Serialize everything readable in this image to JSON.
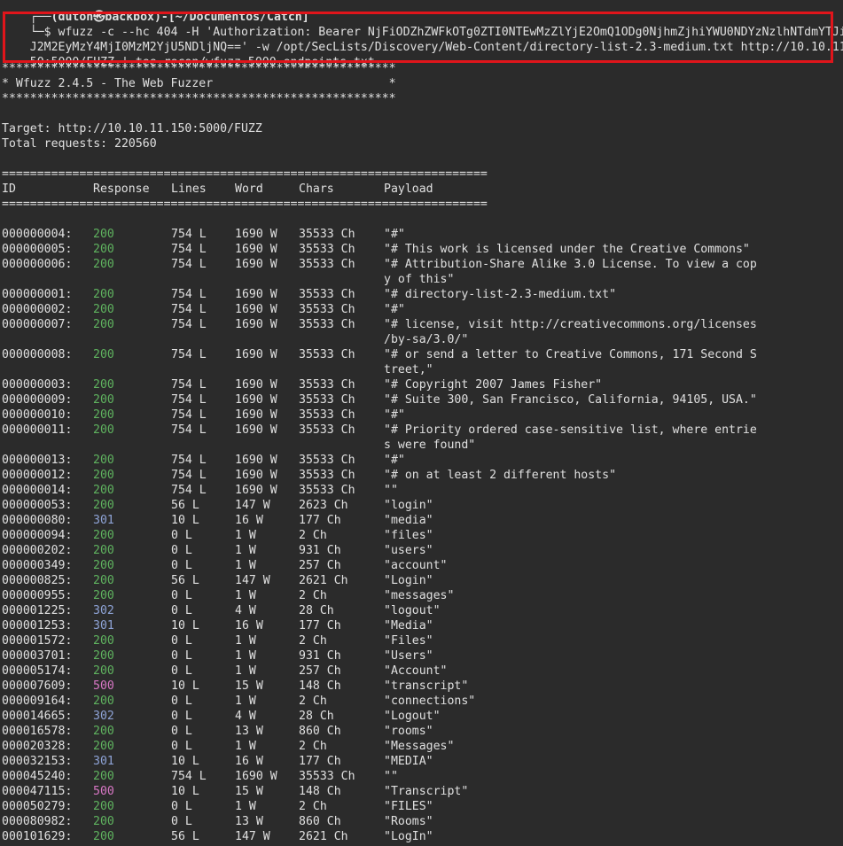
{
  "prompt": {
    "line": "┌──(duton㉿backbox)-[~/Documentos/Catch]",
    "dollar": "└─$",
    "command": [
      " wfuzz -c --hc 404 -H 'Authorization: Bearer NjFiODZhZWFkOTg0ZTI0NTEwMzZlYjE2OmQ1ODg0NjhmZjhiYWU0NDYzNzlhNTdmYTJiN",
      "J2M2EyMzY4MjI0MzM2YjU5NDljNQ==' -w /opt/SecLists/Discovery/Web-Content/directory-list-2.3-medium.txt http://10.10.11.1",
      "50:5000/FUZZ | tee recon/wfuzz-5000-endpoints.txt"
    ]
  },
  "banner": {
    "stars": "********************************************************",
    "title": "* Wfuzz 2.4.5 - The Web Fuzzer                         *"
  },
  "target_line": "Target: http://10.10.11.150:5000/FUZZ",
  "total_line": "Total requests: 220560",
  "separator": "=====================================================================",
  "headers": {
    "id": "ID",
    "response": "Response",
    "lines": "Lines",
    "word": "Word",
    "chars": "Chars",
    "payload": "Payload"
  },
  "colors": {
    "status_2xx": "#5fb35f",
    "status_3xx": "#8ea3d6",
    "status_5xx": "#d877c5",
    "highlight": "#e0151b"
  },
  "results": [
    {
      "id": "000000004:",
      "code": "200",
      "lines": "754 L",
      "words": "1690 W",
      "chars": "35533 Ch",
      "payload": [
        "\"#\""
      ]
    },
    {
      "id": "000000005:",
      "code": "200",
      "lines": "754 L",
      "words": "1690 W",
      "chars": "35533 Ch",
      "payload": [
        "\"# This work is licensed under the Creative Commons\""
      ]
    },
    {
      "id": "000000006:",
      "code": "200",
      "lines": "754 L",
      "words": "1690 W",
      "chars": "35533 Ch",
      "payload": [
        "\"# Attribution-Share Alike 3.0 License. To view a cop",
        "y of this\""
      ]
    },
    {
      "id": "000000001:",
      "code": "200",
      "lines": "754 L",
      "words": "1690 W",
      "chars": "35533 Ch",
      "payload": [
        "\"# directory-list-2.3-medium.txt\""
      ]
    },
    {
      "id": "000000002:",
      "code": "200",
      "lines": "754 L",
      "words": "1690 W",
      "chars": "35533 Ch",
      "payload": [
        "\"#\""
      ]
    },
    {
      "id": "000000007:",
      "code": "200",
      "lines": "754 L",
      "words": "1690 W",
      "chars": "35533 Ch",
      "payload": [
        "\"# license, visit http://creativecommons.org/licenses",
        "/by-sa/3.0/\""
      ]
    },
    {
      "id": "000000008:",
      "code": "200",
      "lines": "754 L",
      "words": "1690 W",
      "chars": "35533 Ch",
      "payload": [
        "\"# or send a letter to Creative Commons, 171 Second S",
        "treet,\""
      ]
    },
    {
      "id": "000000003:",
      "code": "200",
      "lines": "754 L",
      "words": "1690 W",
      "chars": "35533 Ch",
      "payload": [
        "\"# Copyright 2007 James Fisher\""
      ]
    },
    {
      "id": "000000009:",
      "code": "200",
      "lines": "754 L",
      "words": "1690 W",
      "chars": "35533 Ch",
      "payload": [
        "\"# Suite 300, San Francisco, California, 94105, USA.\""
      ]
    },
    {
      "id": "000000010:",
      "code": "200",
      "lines": "754 L",
      "words": "1690 W",
      "chars": "35533 Ch",
      "payload": [
        "\"#\""
      ]
    },
    {
      "id": "000000011:",
      "code": "200",
      "lines": "754 L",
      "words": "1690 W",
      "chars": "35533 Ch",
      "payload": [
        "\"# Priority ordered case-sensitive list, where entrie",
        "s were found\""
      ]
    },
    {
      "id": "000000013:",
      "code": "200",
      "lines": "754 L",
      "words": "1690 W",
      "chars": "35533 Ch",
      "payload": [
        "\"#\""
      ]
    },
    {
      "id": "000000012:",
      "code": "200",
      "lines": "754 L",
      "words": "1690 W",
      "chars": "35533 Ch",
      "payload": [
        "\"# on at least 2 different hosts\""
      ]
    },
    {
      "id": "000000014:",
      "code": "200",
      "lines": "754 L",
      "words": "1690 W",
      "chars": "35533 Ch",
      "payload": [
        "\"\""
      ]
    },
    {
      "id": "000000053:",
      "code": "200",
      "lines": "56 L",
      "words": "147 W",
      "chars": "2623 Ch",
      "payload": [
        "\"login\""
      ]
    },
    {
      "id": "000000080:",
      "code": "301",
      "lines": "10 L",
      "words": "16 W",
      "chars": "177 Ch",
      "payload": [
        "\"media\""
      ]
    },
    {
      "id": "000000094:",
      "code": "200",
      "lines": "0 L",
      "words": "1 W",
      "chars": "2 Ch",
      "payload": [
        "\"files\""
      ]
    },
    {
      "id": "000000202:",
      "code": "200",
      "lines": "0 L",
      "words": "1 W",
      "chars": "931 Ch",
      "payload": [
        "\"users\""
      ]
    },
    {
      "id": "000000349:",
      "code": "200",
      "lines": "0 L",
      "words": "1 W",
      "chars": "257 Ch",
      "payload": [
        "\"account\""
      ]
    },
    {
      "id": "000000825:",
      "code": "200",
      "lines": "56 L",
      "words": "147 W",
      "chars": "2621 Ch",
      "payload": [
        "\"Login\""
      ]
    },
    {
      "id": "000000955:",
      "code": "200",
      "lines": "0 L",
      "words": "1 W",
      "chars": "2 Ch",
      "payload": [
        "\"messages\""
      ]
    },
    {
      "id": "000001225:",
      "code": "302",
      "lines": "0 L",
      "words": "4 W",
      "chars": "28 Ch",
      "payload": [
        "\"logout\""
      ]
    },
    {
      "id": "000001253:",
      "code": "301",
      "lines": "10 L",
      "words": "16 W",
      "chars": "177 Ch",
      "payload": [
        "\"Media\""
      ]
    },
    {
      "id": "000001572:",
      "code": "200",
      "lines": "0 L",
      "words": "1 W",
      "chars": "2 Ch",
      "payload": [
        "\"Files\""
      ]
    },
    {
      "id": "000003701:",
      "code": "200",
      "lines": "0 L",
      "words": "1 W",
      "chars": "931 Ch",
      "payload": [
        "\"Users\""
      ]
    },
    {
      "id": "000005174:",
      "code": "200",
      "lines": "0 L",
      "words": "1 W",
      "chars": "257 Ch",
      "payload": [
        "\"Account\""
      ]
    },
    {
      "id": "000007609:",
      "code": "500",
      "lines": "10 L",
      "words": "15 W",
      "chars": "148 Ch",
      "payload": [
        "\"transcript\""
      ]
    },
    {
      "id": "000009164:",
      "code": "200",
      "lines": "0 L",
      "words": "1 W",
      "chars": "2 Ch",
      "payload": [
        "\"connections\""
      ]
    },
    {
      "id": "000014665:",
      "code": "302",
      "lines": "0 L",
      "words": "4 W",
      "chars": "28 Ch",
      "payload": [
        "\"Logout\""
      ]
    },
    {
      "id": "000016578:",
      "code": "200",
      "lines": "0 L",
      "words": "13 W",
      "chars": "860 Ch",
      "payload": [
        "\"rooms\""
      ]
    },
    {
      "id": "000020328:",
      "code": "200",
      "lines": "0 L",
      "words": "1 W",
      "chars": "2 Ch",
      "payload": [
        "\"Messages\""
      ]
    },
    {
      "id": "000032153:",
      "code": "301",
      "lines": "10 L",
      "words": "16 W",
      "chars": "177 Ch",
      "payload": [
        "\"MEDIA\""
      ]
    },
    {
      "id": "000045240:",
      "code": "200",
      "lines": "754 L",
      "words": "1690 W",
      "chars": "35533 Ch",
      "payload": [
        "\"\""
      ]
    },
    {
      "id": "000047115:",
      "code": "500",
      "lines": "10 L",
      "words": "15 W",
      "chars": "148 Ch",
      "payload": [
        "\"Transcript\""
      ]
    },
    {
      "id": "000050279:",
      "code": "200",
      "lines": "0 L",
      "words": "1 W",
      "chars": "2 Ch",
      "payload": [
        "\"FILES\""
      ]
    },
    {
      "id": "000080982:",
      "code": "200",
      "lines": "0 L",
      "words": "13 W",
      "chars": "860 Ch",
      "payload": [
        "\"Rooms\""
      ]
    },
    {
      "id": "000101629:",
      "code": "200",
      "lines": "56 L",
      "words": "147 W",
      "chars": "2621 Ch",
      "payload": [
        "\"LogIn\""
      ]
    }
  ]
}
